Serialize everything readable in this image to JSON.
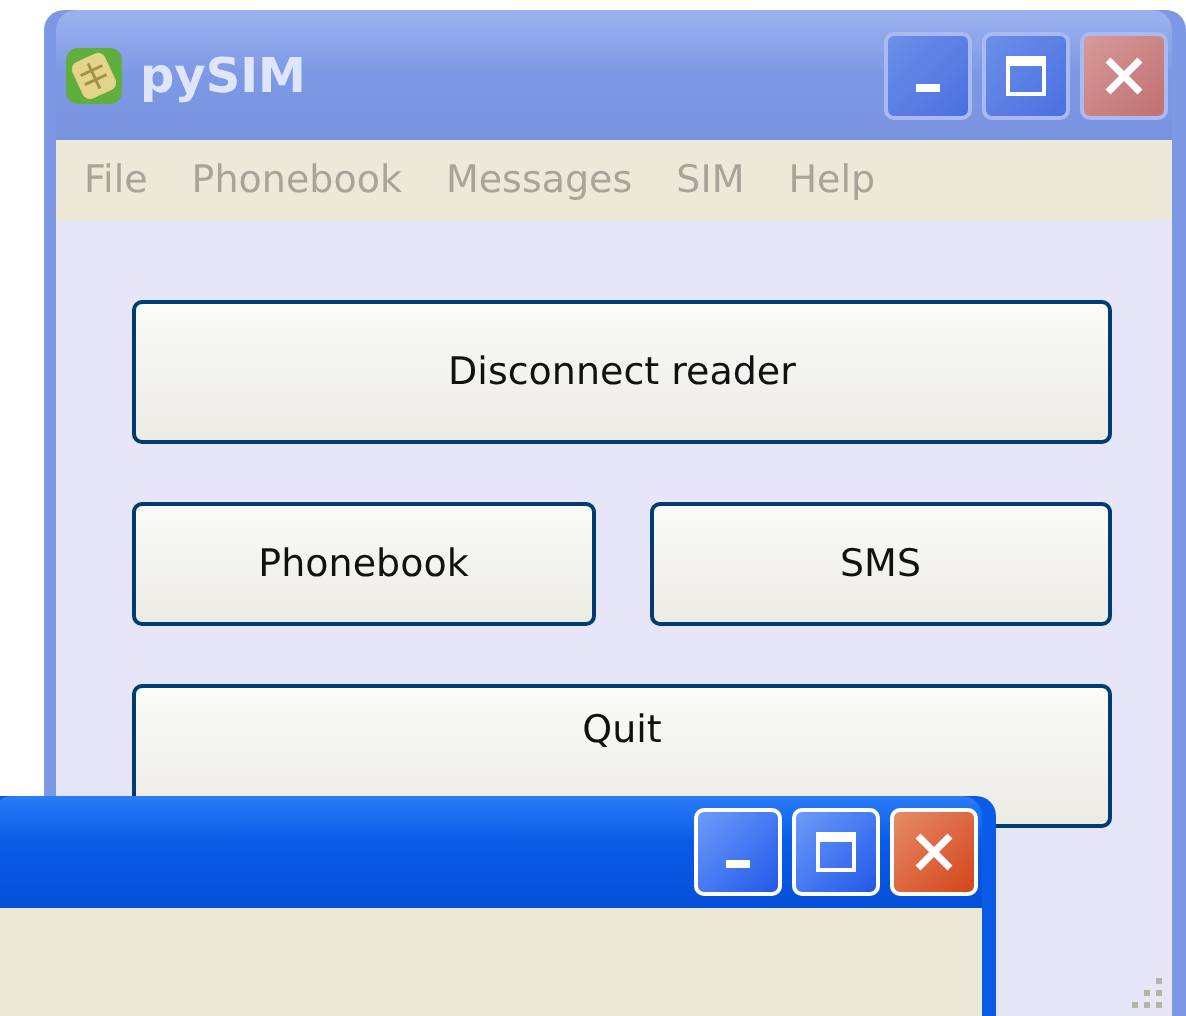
{
  "windows": [
    {
      "title": "pySIM",
      "active": false,
      "menu": [
        "File",
        "Phonebook",
        "Messages",
        "SIM",
        "Help"
      ],
      "buttons": [
        {
          "label": "Disconnect reader",
          "kind": "wide"
        },
        {
          "label": "Phonebook",
          "kind": "half"
        },
        {
          "label": "SMS",
          "kind": "half"
        },
        {
          "label": "Quit",
          "kind": "wide"
        }
      ]
    },
    {
      "active": true
    }
  ]
}
